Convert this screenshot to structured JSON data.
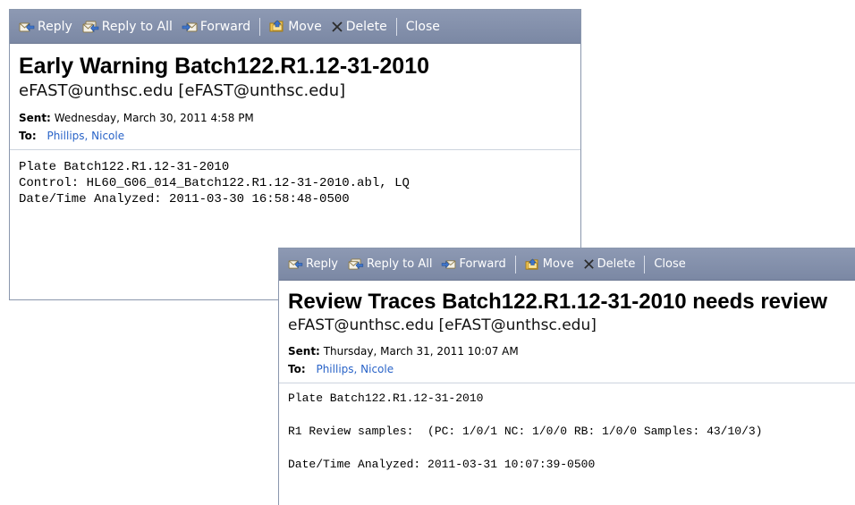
{
  "toolbar": {
    "reply": "Reply",
    "reply_all": "Reply to All",
    "forward": "Forward",
    "move": "Move",
    "delete": "Delete",
    "close": "Close"
  },
  "messages": [
    {
      "subject": "Early Warning Batch122.R1.12-31-2010",
      "sender": "eFAST@unthsc.edu [eFAST@unthsc.edu]",
      "sent_label": "Sent:",
      "sent": "Wednesday, March 30, 2011 4:58 PM",
      "to_label": "To:",
      "to": "Phillips, Nicole",
      "body": [
        "Plate Batch122.R1.12-31-2010",
        "Control: HL60_G06_014_Batch122.R1.12-31-2010.abl, LQ",
        "Date/Time Analyzed: 2011-03-30 16:58:48-0500"
      ]
    },
    {
      "subject": "Review Traces Batch122.R1.12-31-2010 needs review",
      "sender": "eFAST@unthsc.edu [eFAST@unthsc.edu]",
      "sent_label": "Sent:",
      "sent": "Thursday, March 31, 2011 10:07 AM",
      "to_label": "To:",
      "to": "Phillips, Nicole",
      "body": [
        "Plate Batch122.R1.12-31-2010",
        "R1 Review samples:  (PC: 1/0/1 NC: 1/0/0 RB: 1/0/0 Samples: 43/10/3)",
        "Date/Time Analyzed: 2011-03-31 10:07:39-0500"
      ]
    }
  ],
  "colors": {
    "toolbar_bg": "#8491ac",
    "link": "#2a64c8",
    "border": "#8a97ad"
  },
  "icons": [
    "reply-icon",
    "reply-all-icon",
    "forward-icon",
    "move-icon",
    "delete-icon"
  ]
}
